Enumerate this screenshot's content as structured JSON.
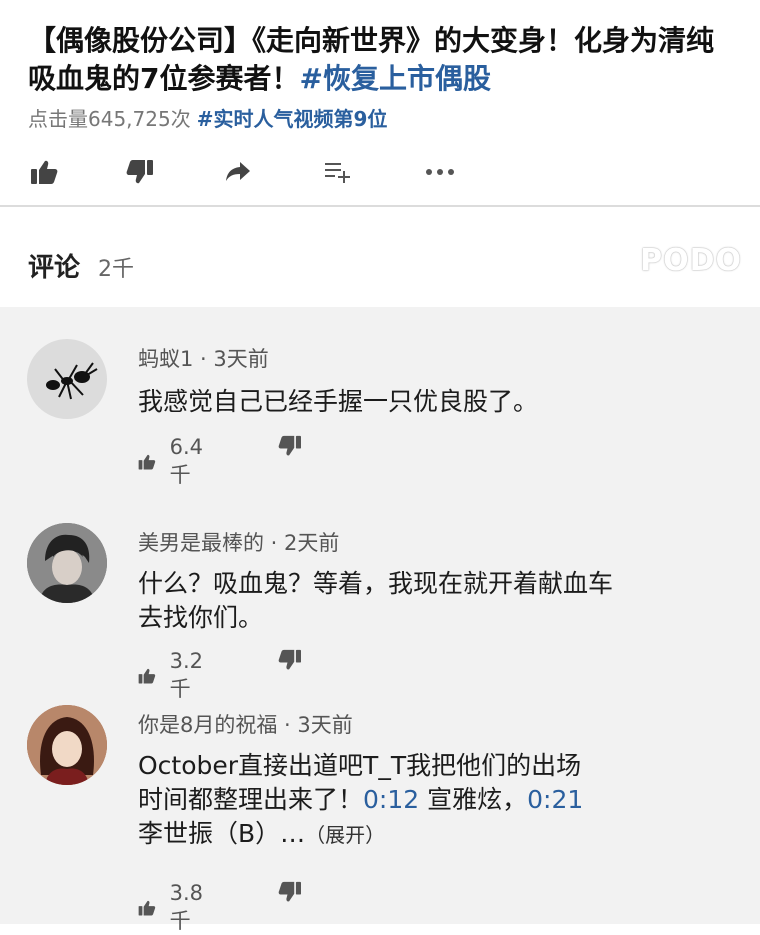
{
  "video": {
    "title_main": "【偶像股份公司】《走向新世界》的大变身！化身为清纯吸血鬼的7位参赛者！",
    "title_tag": "#恢复上市偶股",
    "views": "点击量645,725次",
    "trend_tag": "#实时人气视频第9位"
  },
  "actions": {
    "icons": [
      "thumbs-up-icon",
      "thumbs-down-icon",
      "share-icon",
      "add-to-playlist-icon",
      "more-icon"
    ]
  },
  "comments_section": {
    "label": "评论",
    "count": "2千",
    "watermark": "PODO"
  },
  "comments": [
    {
      "author": "蚂蚁1 · 3天前",
      "text": "我感觉自己已经手握一只优良股了。",
      "likes": "6.4千",
      "avatar": "ant-avatar"
    },
    {
      "author": "美男是最棒的 · 2天前",
      "text_line1": "什么？吸血鬼？等着，我现在就开着献血车",
      "text_line2": "去找你们。",
      "likes": "3.2千",
      "avatar": "man-avatar"
    },
    {
      "author": "你是8月的祝福 · 3天前",
      "text_line1": "October直接出道吧T_T我把他们的出场",
      "line2_pre": "时间都整理出来了！",
      "ts1": "0:12",
      "line2_mid": " 宣雅炫，",
      "ts2": "0:21",
      "line3": "李世振（B）…",
      "expand": "（展开）",
      "likes": "3.8千",
      "avatar": "girl-avatar"
    }
  ],
  "colors": {
    "link": "#2a5f9e",
    "list_bg": "#f2f2f2"
  }
}
